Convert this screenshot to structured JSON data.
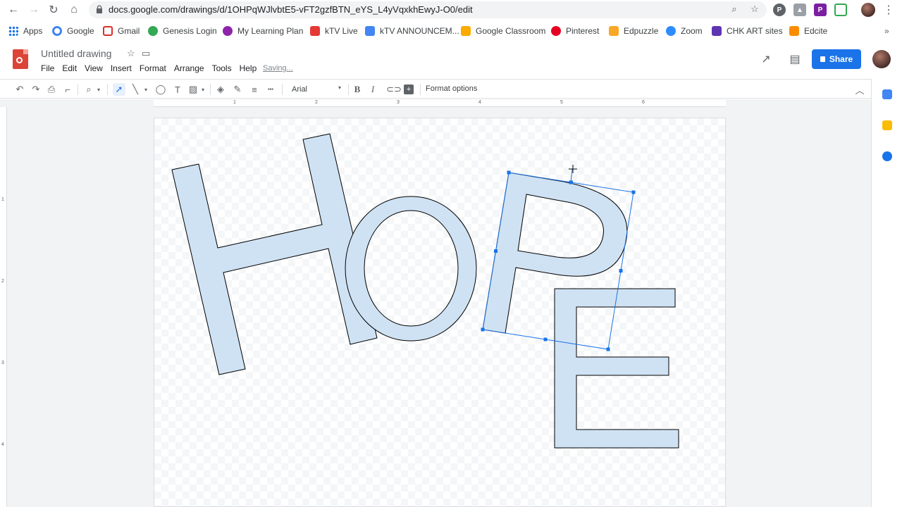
{
  "browser": {
    "url": "docs.google.com/drawings/d/1OHPqWJlvbtE5-vFT2gzfBTN_eYS_L4yVqxkhEwyJ-O0/edit",
    "extension_badge": "P"
  },
  "bookmarks": [
    {
      "label": "Apps",
      "icon": "apps-grid-icon",
      "color": "#1a73e8"
    },
    {
      "label": "Google",
      "icon": "google-icon",
      "color": "#4285f4"
    },
    {
      "label": "Gmail",
      "icon": "gmail-icon",
      "color": "#d93025"
    },
    {
      "label": "Genesis Login",
      "icon": "genesis-icon",
      "color": "#34a853"
    },
    {
      "label": "My Learning Plan",
      "icon": "learning-plan-icon",
      "color": "#8e24aa"
    },
    {
      "label": "kTV Live",
      "icon": "youtube-icon",
      "color": "#e53935"
    },
    {
      "label": "kTV ANNOUNCEM...",
      "icon": "docs-icon",
      "color": "#4285f4"
    },
    {
      "label": "Google Classroom",
      "icon": "classroom-icon",
      "color": "#f9ab00"
    },
    {
      "label": "Pinterest",
      "icon": "pinterest-icon",
      "color": "#e60023"
    },
    {
      "label": "Edpuzzle",
      "icon": "edpuzzle-icon",
      "color": "#f9a825"
    },
    {
      "label": "Zoom",
      "icon": "zoom-icon",
      "color": "#2d8cff"
    },
    {
      "label": "CHK ART sites",
      "icon": "sites-icon",
      "color": "#5e35b1"
    },
    {
      "label": "Edcite",
      "icon": "edcite-icon",
      "color": "#fb8c00"
    }
  ],
  "app": {
    "title": "Untitled drawing",
    "menu": [
      "File",
      "Edit",
      "View",
      "Insert",
      "Format",
      "Arrange",
      "Tools",
      "Help"
    ],
    "status": "Saving...",
    "share_label": "Share"
  },
  "toolbar": {
    "font": "Arial",
    "format_options": "Format options"
  },
  "ruler": {
    "top_ticks": [
      "1",
      "2",
      "3",
      "4",
      "5",
      "6"
    ],
    "left_ticks": [
      "1",
      "2",
      "3",
      "4"
    ]
  },
  "drawing": {
    "fill_color": "#cfe2f3",
    "stroke_color": "#000000",
    "selection_color": "#1a73e8",
    "letters": [
      "H",
      "O",
      "P",
      "E"
    ],
    "selected_letter": "P"
  }
}
